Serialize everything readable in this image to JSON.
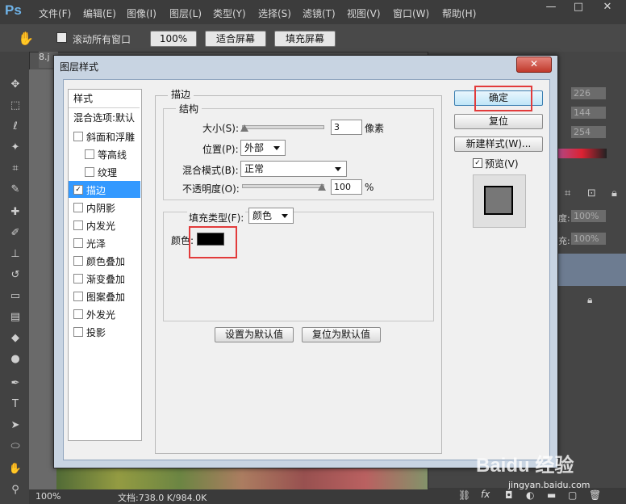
{
  "app": {
    "logo": "Ps",
    "menu": [
      "文件(F)",
      "编辑(E)",
      "图像(I)",
      "图层(L)",
      "类型(Y)",
      "选择(S)",
      "滤镜(T)",
      "视图(V)",
      "窗口(W)",
      "帮助(H)"
    ],
    "window_buttons": [
      "—",
      "□",
      "✕"
    ]
  },
  "options_bar": {
    "scroll_all_label": "滚动所有窗口",
    "zoom_100": "100%",
    "fit_screen": "适合屏幕",
    "fill_screen": "填充屏幕"
  },
  "canvas": {
    "tab_label": "8.j",
    "zoom": "100%",
    "doc_info": "文档:738.0 K/984.0K"
  },
  "right_panel": {
    "rgb_values": [
      "226",
      "144",
      "254"
    ],
    "opacity_label": "度:",
    "opacity_value": "100%",
    "fill_label": "充:",
    "fill_value": "100%",
    "icons": [
      "fx"
    ]
  },
  "dialog": {
    "title": "图层样式",
    "close": "✕",
    "styles_header": "样式",
    "blend_options": "混合选项:默认",
    "style_items": [
      {
        "label": "斜面和浮雕",
        "checked": false
      },
      {
        "label": "等高线",
        "checked": false
      },
      {
        "label": "纹理",
        "checked": false
      },
      {
        "label": "描边",
        "checked": true
      },
      {
        "label": "内阴影",
        "checked": false
      },
      {
        "label": "内发光",
        "checked": false
      },
      {
        "label": "光泽",
        "checked": false
      },
      {
        "label": "颜色叠加",
        "checked": false
      },
      {
        "label": "渐变叠加",
        "checked": false
      },
      {
        "label": "图案叠加",
        "checked": false
      },
      {
        "label": "外发光",
        "checked": false
      },
      {
        "label": "投影",
        "checked": false
      }
    ],
    "stroke": {
      "title": "描边",
      "structure_title": "结构",
      "size_label": "大小(S):",
      "size_value": "3",
      "size_unit": "像素",
      "position_label": "位置(P):",
      "position_value": "外部",
      "blend_label": "混合模式(B):",
      "blend_value": "正常",
      "opacity_label": "不透明度(O):",
      "opacity_value": "100",
      "opacity_unit": "%",
      "fill_type_label": "填充类型(F):",
      "fill_type_value": "颜色",
      "color_label": "颜色:",
      "stroke_color": "#000000"
    },
    "buttons": {
      "set_default": "设置为默认值",
      "reset_default": "复位为默认值",
      "ok": "确定",
      "reset": "复位",
      "new_style": "新建样式(W)...",
      "preview_label": "预览(V)"
    }
  },
  "watermark": {
    "brand": "Baidu 经验",
    "url": "jingyan.baidu.com"
  }
}
